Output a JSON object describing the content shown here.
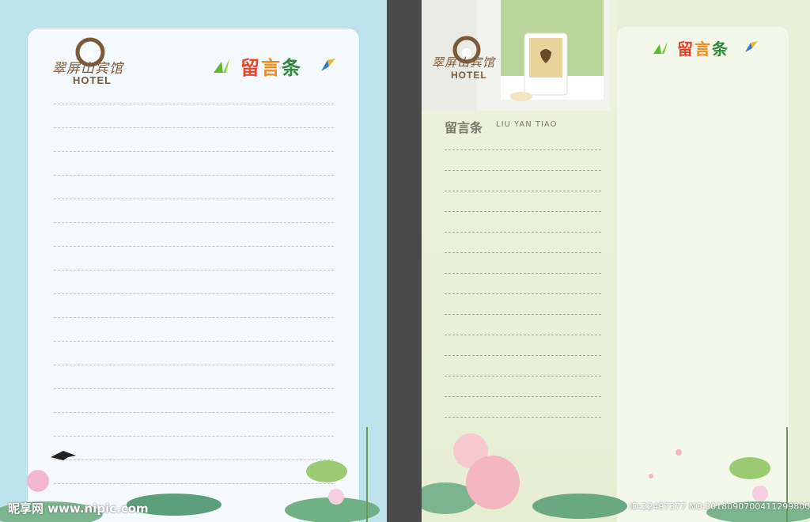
{
  "left_note": {
    "logo": {
      "name_cn": "翠屏山宾馆",
      "name_en": "HOTEL"
    },
    "title": {
      "chars": [
        "留",
        "言",
        "条"
      ]
    }
  },
  "right_note": {
    "logo": {
      "name_cn": "翠屏山宾馆",
      "name_en": "HOTEL"
    },
    "heading_cn": "留言条",
    "heading_pinyin": "LIU YAN TIAO",
    "card_title": {
      "chars": [
        "留",
        "言",
        "条"
      ]
    }
  },
  "watermark": {
    "site": "昵享网 www.nipic.com",
    "id": "ID:22497377 NO:20180907004112998000"
  },
  "colors": {
    "left_bg": "#bfe3ec",
    "right_bg": "#e9f0d8",
    "dash_blue": "#9fd3df",
    "dash_green": "#8fc23c",
    "title_red": "#e8442a",
    "title_orange": "#f08a1c",
    "title_green": "#2e8a3a",
    "logo_brown": "#7a5a3a"
  }
}
